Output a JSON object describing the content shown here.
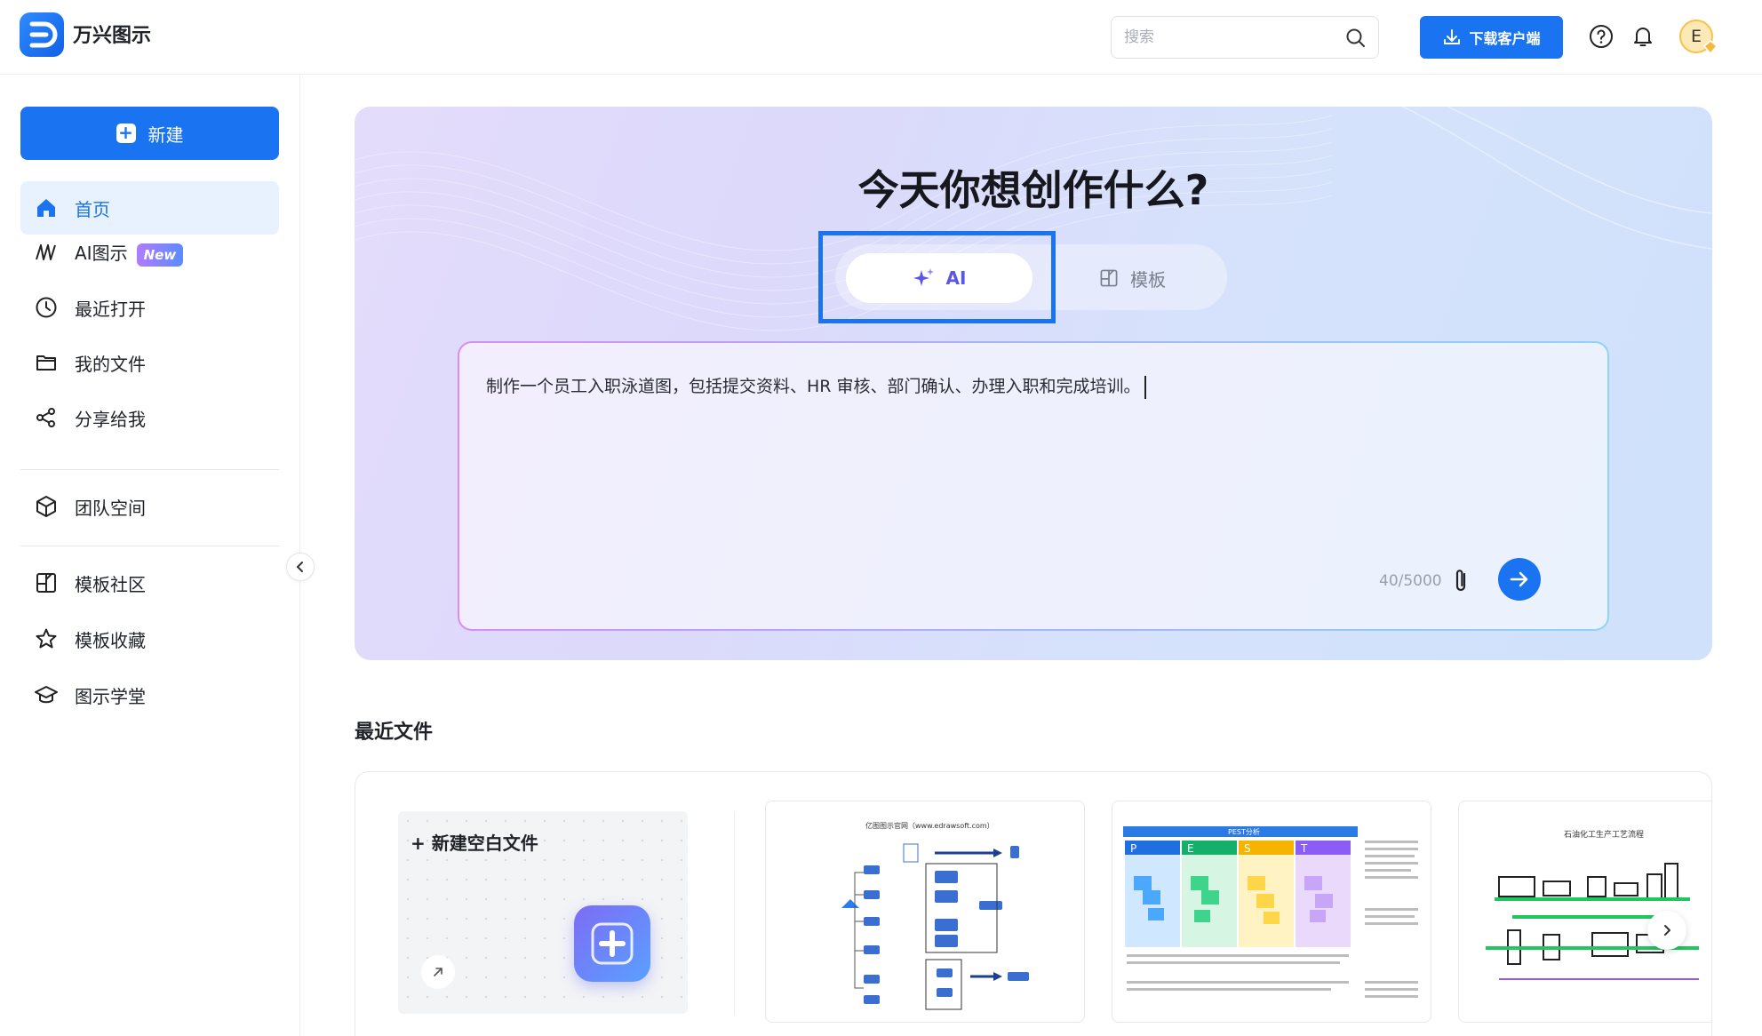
{
  "header": {
    "app_name": "万兴图示",
    "search_placeholder": "搜索",
    "download_label": "下载客户端",
    "avatar_initial": "E"
  },
  "sidebar": {
    "new_label": "新建",
    "items": [
      {
        "label": "首页",
        "icon": "home-icon",
        "active": true
      },
      {
        "label": "AI图示",
        "icon": "ai-diagram-icon",
        "badge": "New"
      },
      {
        "label": "最近打开",
        "icon": "clock-icon"
      },
      {
        "label": "我的文件",
        "icon": "folder-icon"
      },
      {
        "label": "分享给我",
        "icon": "share-icon"
      },
      {
        "label": "团队空间",
        "icon": "cube-icon"
      },
      {
        "label": "模板社区",
        "icon": "template-icon"
      },
      {
        "label": "模板收藏",
        "icon": "star-icon"
      },
      {
        "label": "图示学堂",
        "icon": "graduation-icon"
      }
    ]
  },
  "hero": {
    "title": "今天你想创作什么?",
    "tabs": [
      {
        "label": "AI",
        "icon": "sparkle-icon",
        "active": true
      },
      {
        "label": "模板",
        "icon": "template-icon"
      }
    ],
    "prompt_text": "制作一个员工入职泳道图，包括提交资料、HR 审核、部门确认、办理入职和完成培训。",
    "char_count": "40/5000"
  },
  "recent": {
    "title": "最近文件",
    "new_blank_label": "+ 新建空白文件",
    "cards": [
      {
        "caption": "亿图图示官网（www.edrawsoft.com）"
      },
      {
        "caption": "PEST分析",
        "letters": [
          "P",
          "E",
          "S",
          "T"
        ]
      },
      {
        "caption": "石油化工生产工艺流程"
      }
    ]
  },
  "colors": {
    "primary": "#1a73f0",
    "active_bg": "#e8f2ff",
    "highlight": "#1a73f0"
  }
}
